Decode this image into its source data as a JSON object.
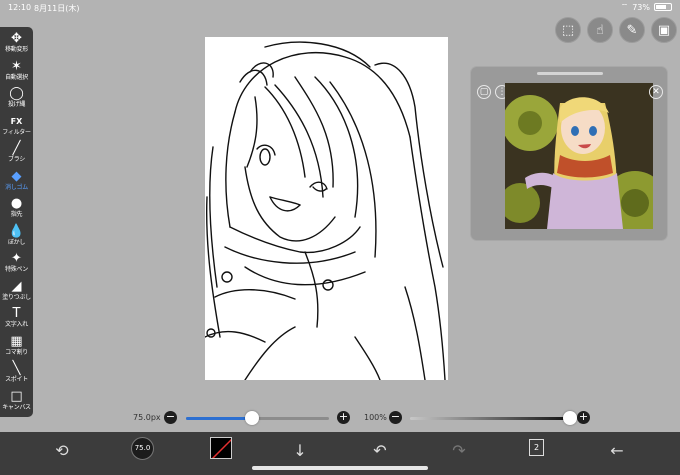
{
  "status": {
    "time": "12:10",
    "date": "8月11日(木)",
    "battery": "73%",
    "battery_level": 0.73
  },
  "tools": [
    {
      "name": "move-transform",
      "icon": "move-arrows-icon",
      "glyph": "✥",
      "label": "移動変形"
    },
    {
      "name": "auto-select",
      "icon": "magic-wand-icon",
      "glyph": "✶",
      "label": "自動選択"
    },
    {
      "name": "lasso",
      "icon": "lasso-icon",
      "glyph": "◯",
      "label": "投げ縄"
    },
    {
      "name": "filter",
      "icon": "fx-icon",
      "glyph": "FX",
      "label": "フィルター"
    },
    {
      "name": "brush",
      "icon": "brush-icon",
      "glyph": "╱",
      "label": "ブラシ"
    },
    {
      "name": "eraser",
      "icon": "eraser-icon",
      "glyph": "◆",
      "label": "消しゴム"
    },
    {
      "name": "smudge",
      "icon": "smudge-icon",
      "glyph": "●",
      "label": "指先"
    },
    {
      "name": "blur",
      "icon": "drop-icon",
      "glyph": "💧",
      "label": "ぼかし"
    },
    {
      "name": "special-pen",
      "icon": "sparkle-pen-icon",
      "glyph": "✦",
      "label": "特殊ペン"
    },
    {
      "name": "fill",
      "icon": "bucket-icon",
      "glyph": "◢",
      "label": "塗りつぶし"
    },
    {
      "name": "text",
      "icon": "text-icon",
      "glyph": "T",
      "label": "文字入れ"
    },
    {
      "name": "frame-divider",
      "icon": "frame-icon",
      "glyph": "▦",
      "label": "コマ割り"
    },
    {
      "name": "eyedropper",
      "icon": "eyedropper-icon",
      "glyph": "╲",
      "label": "スポイト"
    },
    {
      "name": "canvas",
      "icon": "canvas-icon",
      "glyph": "□",
      "label": "キャンバス"
    }
  ],
  "active_tool": "eraser",
  "top_buttons": [
    {
      "name": "selection",
      "icon": "selection-icon",
      "glyph": "⬚"
    },
    {
      "name": "hand",
      "icon": "hand-icon",
      "glyph": "☝"
    },
    {
      "name": "ruler",
      "icon": "ruler-icon",
      "glyph": "✎"
    },
    {
      "name": "material",
      "icon": "image-icon",
      "glyph": "▣"
    }
  ],
  "brush": {
    "size_label": "75.0px",
    "size_short": "75.0",
    "size_fraction": 0.46
  },
  "opacity": {
    "label": "100%",
    "fraction": 1.0
  },
  "slider_buttons": {
    "minus": "−",
    "plus": "+"
  },
  "layers": {
    "count": "2"
  },
  "colors": {
    "accent": "#1e6fd9",
    "panel": "#3b3b3b",
    "background": "#b3b3b3"
  }
}
